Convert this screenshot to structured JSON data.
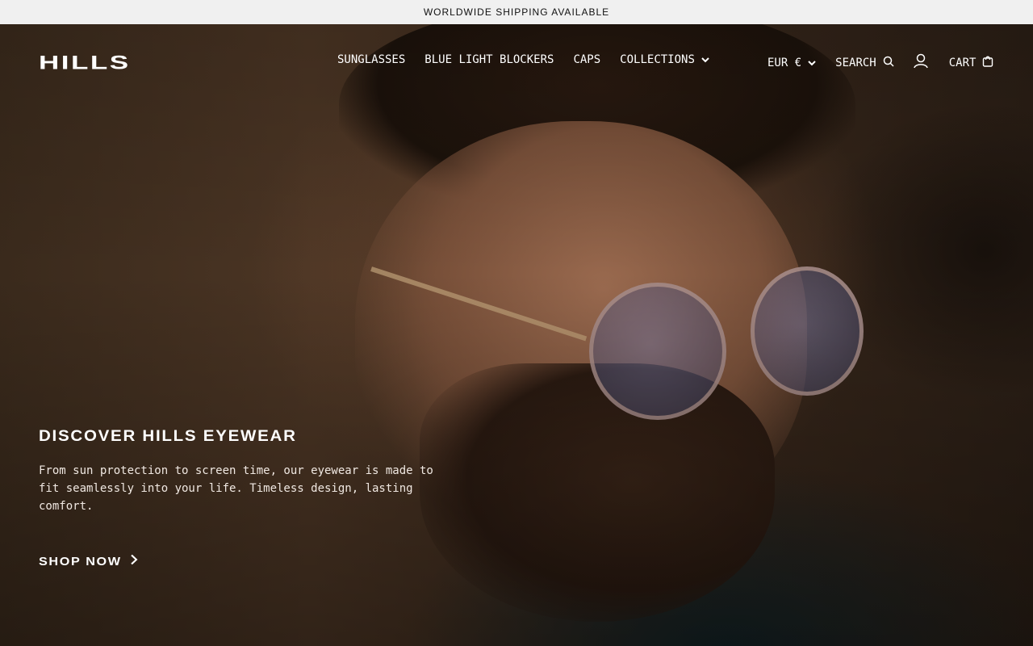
{
  "announcement": {
    "text": "WORLDWIDE SHIPPING AVAILABLE"
  },
  "header": {
    "logo": "HILLS",
    "nav": [
      {
        "label": "SUNGLASSES"
      },
      {
        "label": "BLUE LIGHT BLOCKERS"
      },
      {
        "label": "CAPS"
      },
      {
        "label": "COLLECTIONS",
        "icon": "chevron-down-icon"
      }
    ],
    "currency": {
      "label": "EUR €",
      "icon": "chevron-down-icon"
    },
    "search": {
      "label": "SEARCH",
      "icon": "search-icon"
    },
    "account": {
      "icon": "user-icon"
    },
    "cart": {
      "label": "CART",
      "icon": "bag-icon"
    }
  },
  "hero": {
    "title": "DISCOVER HILLS EYEWEAR",
    "text": "From sun protection to screen time, our eyewear is made to fit seamlessly into your life. Timeless design, lasting comfort.",
    "cta": {
      "label": "SHOP NOW",
      "icon": "chevron-right-icon"
    }
  }
}
